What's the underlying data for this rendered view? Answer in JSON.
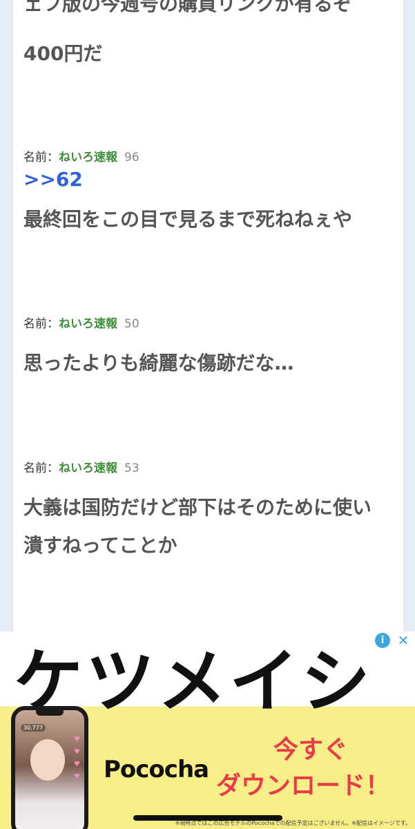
{
  "posts": [
    {
      "lines": [
        "ェフ版の今週号の購買リンクが有るぞ",
        "400円だ"
      ]
    },
    {
      "name_label": "名前：",
      "author": "ねいろ速報",
      "number": "96",
      "anchor": ">>62",
      "lines": [
        "最終回をこの目で見るまで死ねねぇや"
      ]
    },
    {
      "name_label": "名前：",
      "author": "ねいろ速報",
      "number": "50",
      "lines": [
        "思ったよりも綺麗な傷跡だな…"
      ]
    },
    {
      "name_label": "名前：",
      "author": "ねいろ速報",
      "number": "53",
      "lines": [
        "大義は国防だけど部下はそのために使い",
        "潰すねってことか"
      ]
    }
  ],
  "ad": {
    "title": "ケツメイシ",
    "brand": "Pococha",
    "cta_line1": "今すぐ",
    "cta_line2": "ダウンロード！",
    "viewer_count": "30,777",
    "disclaimer": "※現時点ではこの広告モデルのPocochaでの配信予定はございません。※配信はイメージです。",
    "info_icon": "i",
    "close_icon": "✕"
  }
}
